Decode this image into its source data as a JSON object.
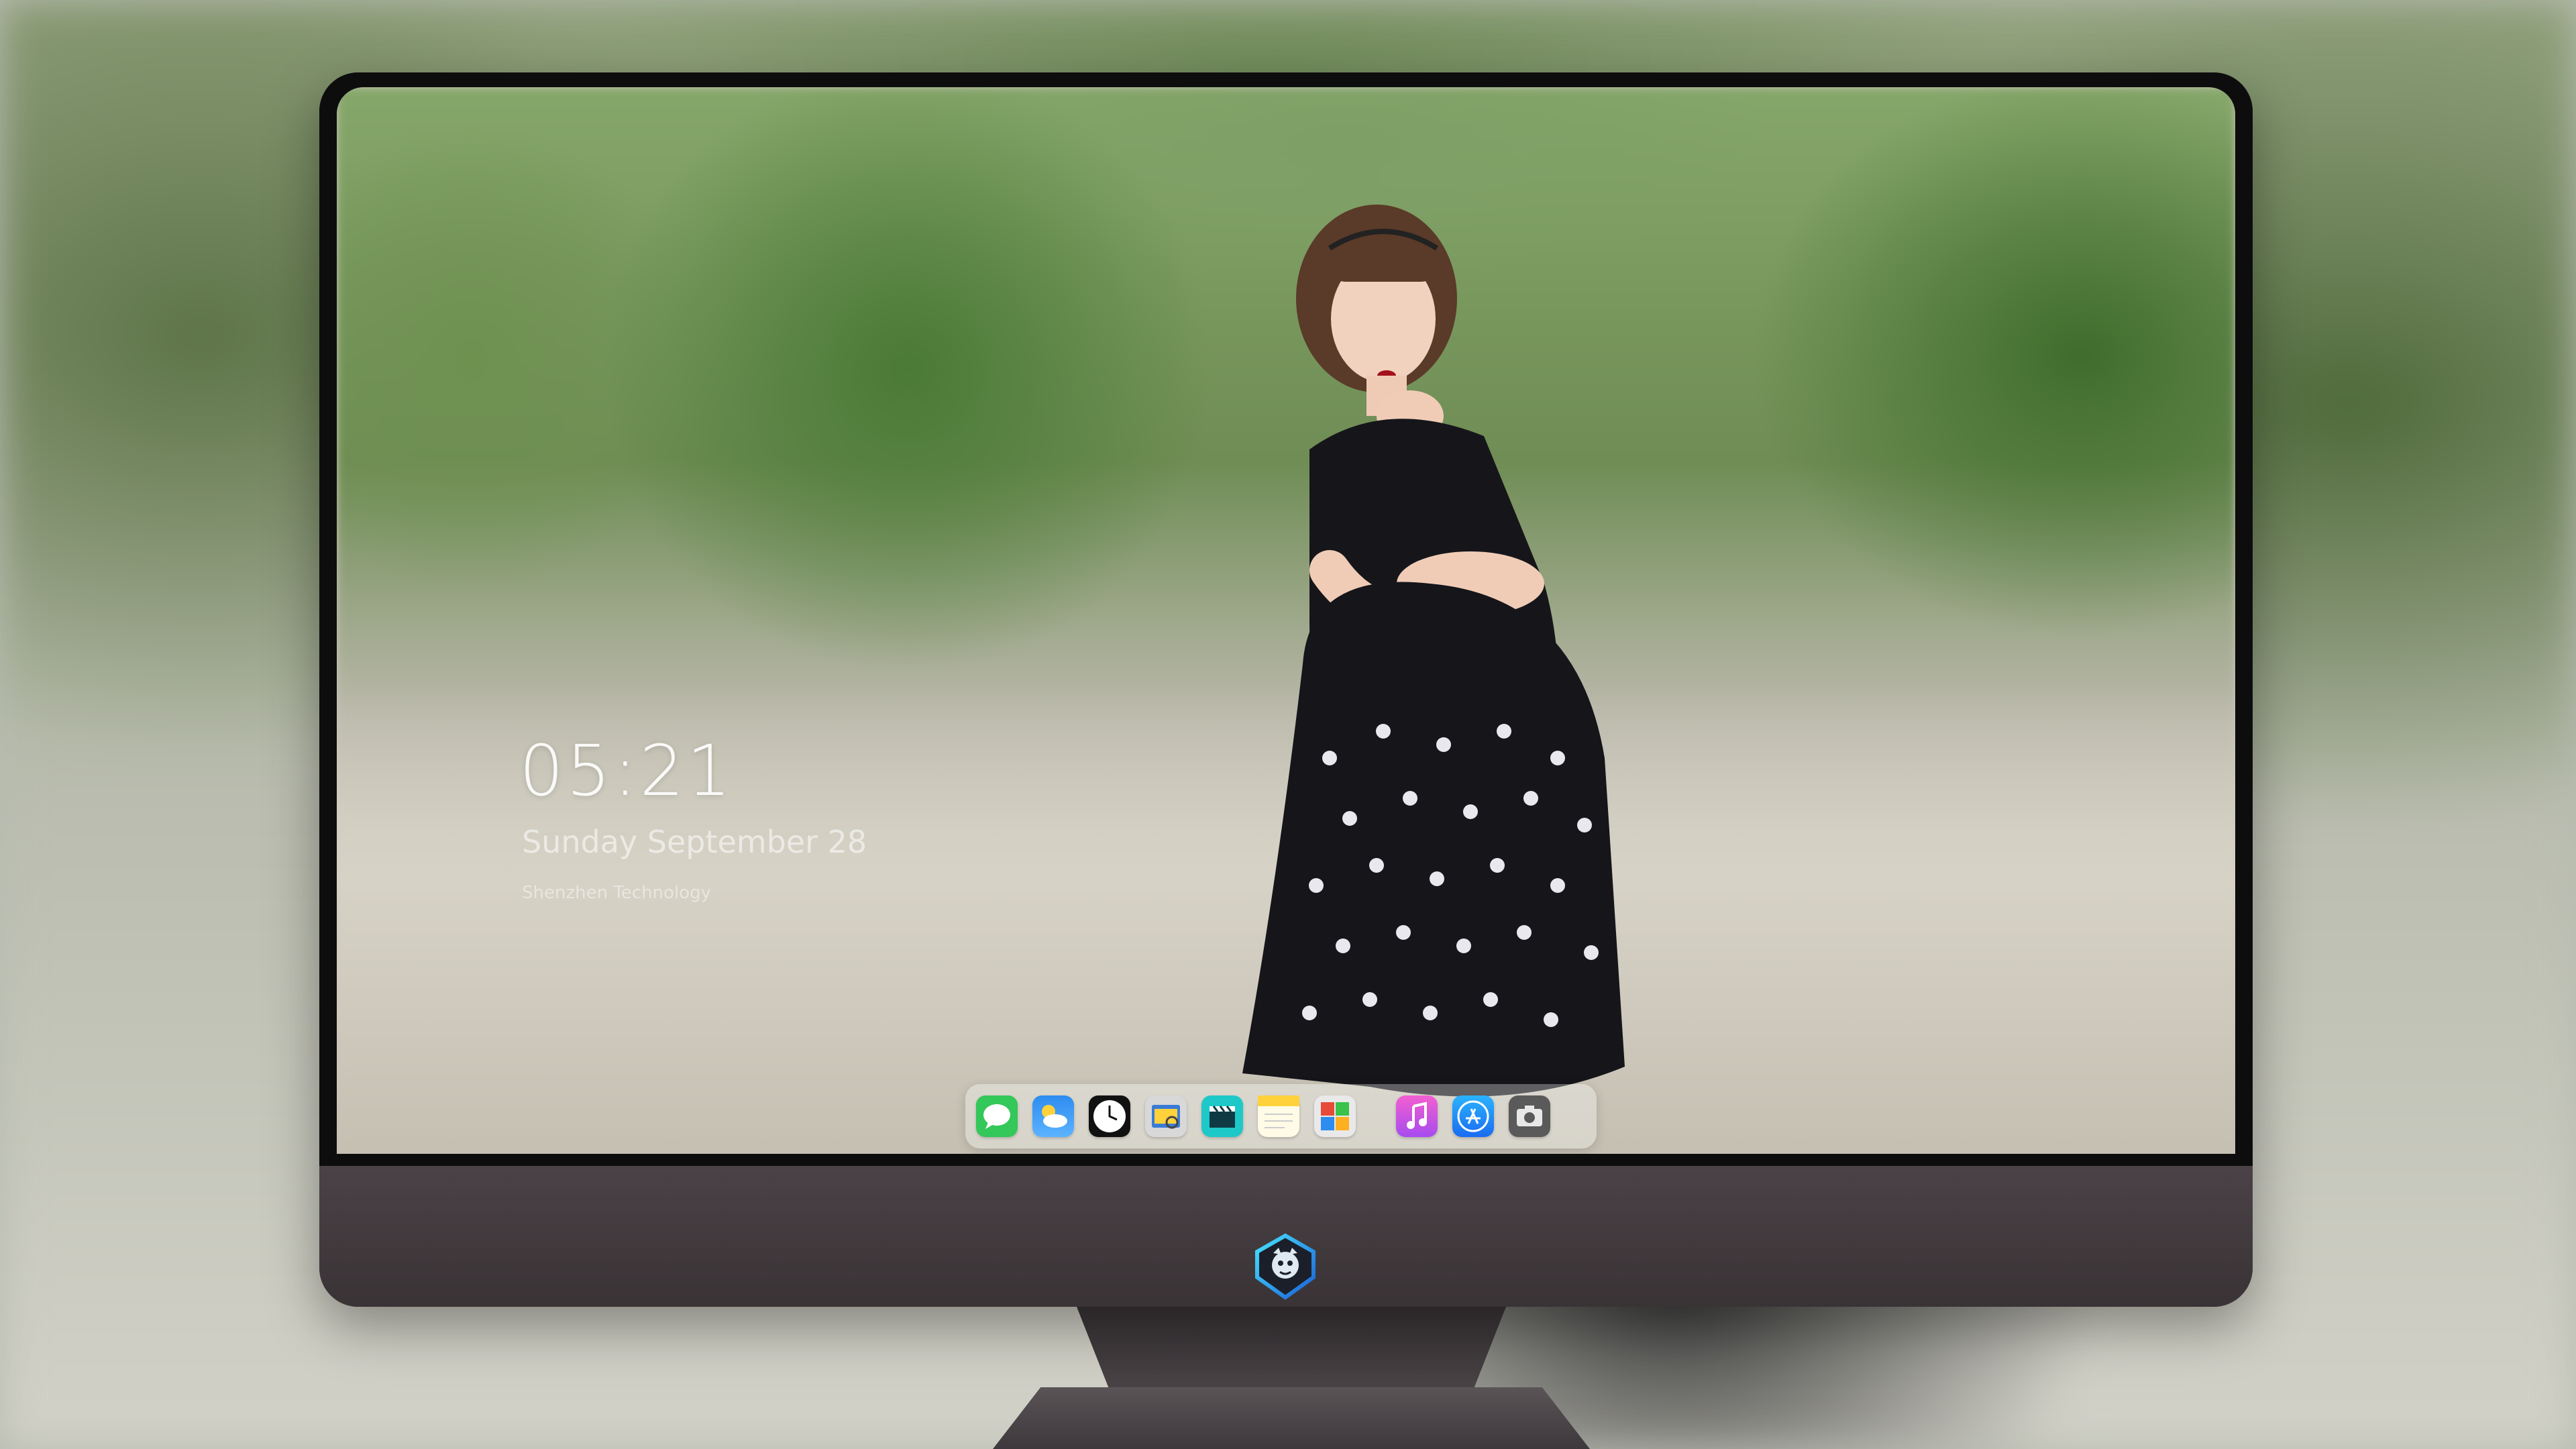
{
  "lock_screen": {
    "time": "05:21",
    "date": "Sunday September 28",
    "subline": "Shenzhen Technology"
  },
  "dock": {
    "apps": [
      {
        "name": "Messages",
        "icon": "messages-icon",
        "color": "#34c759"
      },
      {
        "name": "Weather",
        "icon": "weather-icon",
        "color": "#2d8cf0"
      },
      {
        "name": "Clock",
        "icon": "clock-icon",
        "color": "#111111"
      },
      {
        "name": "Preview",
        "icon": "preview-icon",
        "color": "#d8d8d8"
      },
      {
        "name": "Clips",
        "icon": "clapperboard-icon",
        "color": "#1ec8c8"
      },
      {
        "name": "Notes",
        "icon": "notes-icon",
        "color": "#ffd23c"
      },
      {
        "name": "Photo Booth",
        "icon": "photo-booth-icon",
        "color": "#e9e9e9"
      },
      {
        "name": "iTunes",
        "icon": "music-icon",
        "color": "#d346e8"
      },
      {
        "name": "App Store",
        "icon": "app-store-icon",
        "color": "#1a8cff"
      },
      {
        "name": "Camera",
        "icon": "camera-icon",
        "color": "#4a4a4a"
      }
    ]
  },
  "monitor": {
    "logo": "dragon-shield-logo-icon",
    "frame_color": "#2b2729"
  }
}
